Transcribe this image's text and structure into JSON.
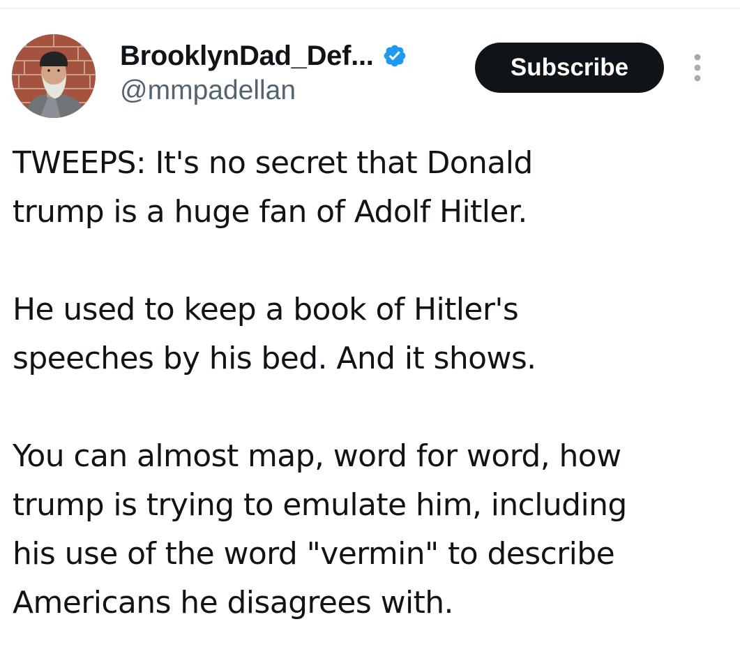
{
  "author": {
    "display_name": "BrooklynDad_Def...",
    "handle": "@mmpadellan",
    "verified": true,
    "verified_color": "#1d9bf0",
    "avatar_icon": "profile-photo"
  },
  "actions": {
    "subscribe_label": "Subscribe",
    "more_icon": "vertical-ellipsis-icon"
  },
  "tweet": {
    "paragraphs": [
      "TWEEPS: It's no secret that Donald\ntrump is a huge fan of Adolf Hitler.",
      "He used to keep a book of Hitler's\nspeeches by his bed. And it shows.",
      "You can almost map, word for word, how\ntrump is trying to emulate him, including\nhis use of the word \"vermin\" to describe\nAmericans he disagrees with."
    ]
  },
  "colors": {
    "text": "#0f1419",
    "secondary_text": "#536471",
    "button_bg": "#0f1419",
    "button_text": "#ffffff",
    "divider": "#eff3f4"
  }
}
